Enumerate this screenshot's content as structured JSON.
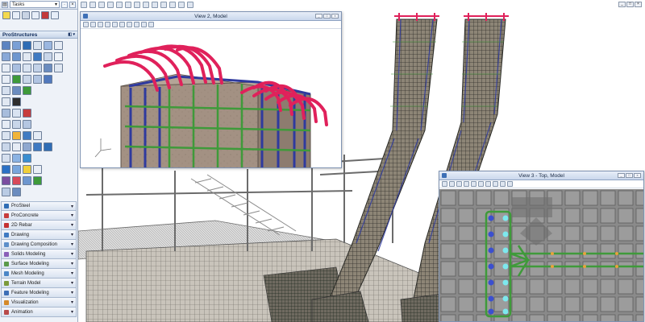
{
  "tasks": {
    "label": "Tasks"
  },
  "toolbox": {
    "title": "ProStructures"
  },
  "categories": [
    {
      "label": "ProSteel",
      "icon_color": "#2f6db5"
    },
    {
      "label": "ProConcrete",
      "icon_color": "#c73d3d"
    },
    {
      "label": "2D Rebar",
      "icon_color": "#c43232"
    },
    {
      "label": "Drawing",
      "icon_color": "#3f7ac2"
    },
    {
      "label": "Drawing Composition",
      "icon_color": "#5d8fc9"
    },
    {
      "label": "Solids Modeling",
      "icon_color": "#8a5fb8"
    },
    {
      "label": "Surface Modeling",
      "icon_color": "#5a9a4a"
    },
    {
      "label": "Mesh Modeling",
      "icon_color": "#4b86c6"
    },
    {
      "label": "Terrain Model",
      "icon_color": "#7c9a3a"
    },
    {
      "label": "Feature Modeling",
      "icon_color": "#3d6fb6"
    },
    {
      "label": "Visualization",
      "icon_color": "#d48a2a"
    },
    {
      "label": "Animation",
      "icon_color": "#b84a4a"
    }
  ],
  "views": {
    "view2": {
      "title": "View 2, Model"
    },
    "view3": {
      "title": "View 3 - Top, Model"
    }
  },
  "icons": [
    "select-icon",
    "dropdown-icon",
    "rebar-icon",
    "shape-icon",
    "view-icon"
  ],
  "colors": {
    "rebar_top": "#e0215b",
    "rebar_vertical": "#2f3a9e",
    "rebar_horizontal": "#3f9a3a",
    "concrete": "#9a8a7a",
    "top_view_grid": "#7a7a7a",
    "top_view_dots_blue": "#3b4fd0",
    "top_view_dots_cyan": "#7de8ee"
  }
}
